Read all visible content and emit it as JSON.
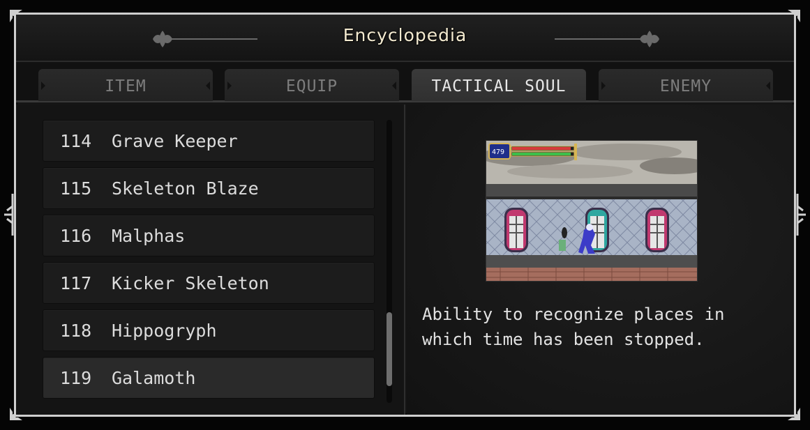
{
  "window": {
    "title": "Encyclopedia"
  },
  "tabs": [
    {
      "label": "ITEM",
      "active": false
    },
    {
      "label": "EQUIP",
      "active": false
    },
    {
      "label": "TACTICAL SOUL",
      "active": true
    },
    {
      "label": "ENEMY",
      "active": false
    }
  ],
  "list": {
    "items": [
      {
        "number": "114",
        "name": "Grave Keeper",
        "selected": false
      },
      {
        "number": "115",
        "name": "Skeleton Blaze",
        "selected": false
      },
      {
        "number": "116",
        "name": "Malphas",
        "selected": false
      },
      {
        "number": "117",
        "name": "Kicker Skeleton",
        "selected": false
      },
      {
        "number": "118",
        "name": "Hippogryph",
        "selected": false
      },
      {
        "number": "119",
        "name": "Galamoth",
        "selected": true
      }
    ],
    "scroll_position": 0.92,
    "scroll_visible_fraction": 0.26
  },
  "detail": {
    "preview_hud_value": "479",
    "description": "Ability to recognize places in which time has been stopped."
  },
  "colors": {
    "title_text": "#f3ead0",
    "tab_active_text": "#e8e8e8",
    "tab_inactive_text": "#7d7d7d",
    "frame_border": "#cfcfcf"
  }
}
